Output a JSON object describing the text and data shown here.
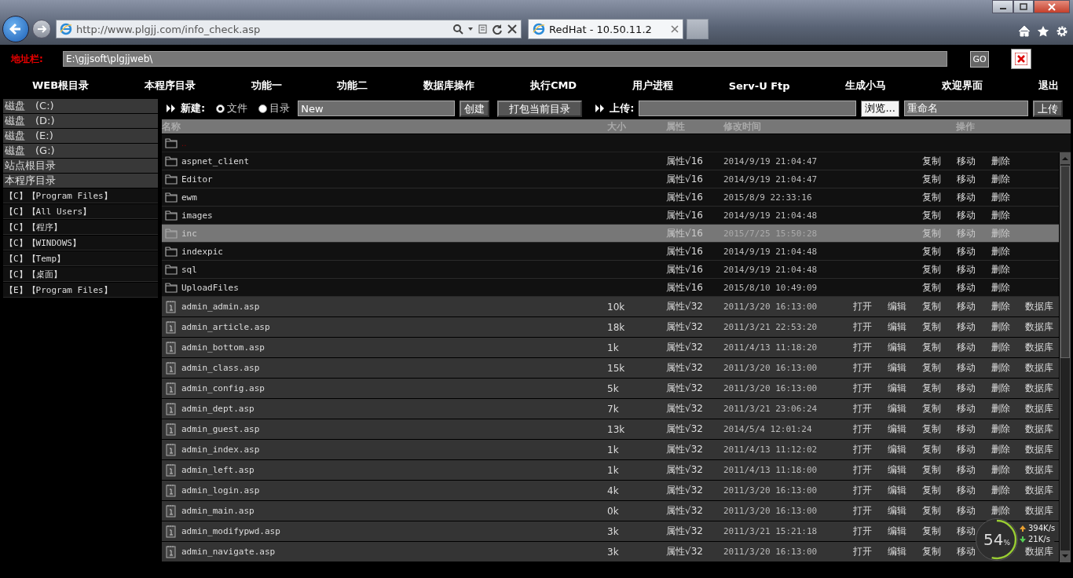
{
  "browser": {
    "url": "http://www.plgjj.com/info_check.asp",
    "tabs": [
      {
        "title": "RedHat - 10.50.11.2",
        "selected": true
      }
    ]
  },
  "address_bar": {
    "label": "地址栏:",
    "value": "E:\\gjjsoft\\plgjjweb\\",
    "go_button": "GO"
  },
  "nav": [
    "WEB根目录",
    "本程序目录",
    "功能一",
    "功能二",
    "数据库操作",
    "执行CMD",
    "用户进程",
    "Serv-U Ftp",
    "生成小马",
    "欢迎界面",
    "退出"
  ],
  "sidebar": {
    "items": [
      {
        "label": "磁盘　(C:)",
        "kind": "root"
      },
      {
        "label": "磁盘　(D:)",
        "kind": "root"
      },
      {
        "label": "磁盘　(E:)",
        "kind": "root"
      },
      {
        "label": "磁盘　(G:)",
        "kind": "root"
      },
      {
        "label": "站点根目录",
        "kind": "root"
      },
      {
        "label": "本程序目录",
        "kind": "root"
      },
      {
        "label": "【C】【Program Files】",
        "kind": "path"
      },
      {
        "label": "【C】【All Users】",
        "kind": "path"
      },
      {
        "label": "【C】【程序】",
        "kind": "path"
      },
      {
        "label": "【C】【WINDOWS】",
        "kind": "path"
      },
      {
        "label": "【C】【Temp】",
        "kind": "path"
      },
      {
        "label": "【C】【桌面】",
        "kind": "path"
      },
      {
        "label": "【E】【Program Files】",
        "kind": "path"
      }
    ]
  },
  "toolbar": {
    "new_label": "新建:",
    "options": [
      {
        "label": "文件",
        "selected": true
      },
      {
        "label": "目录",
        "selected": false
      }
    ],
    "name_value": "New",
    "create_button": "创建",
    "pack_button": "打包当前目录",
    "upload_label": "上传:",
    "browse_button": "浏览...",
    "rename_value": "重命名",
    "upload_button": "上传"
  },
  "table": {
    "columns": [
      "名称",
      "大小",
      "属性",
      "修改时间",
      "操作"
    ],
    "parent_row": {
      "name": ".."
    },
    "rows": [
      {
        "kind": "folder",
        "name": "aspnet_client",
        "attr": "属性√16",
        "time": "2014/9/19 21:04:47",
        "selected": false,
        "ops": [
          {
            "kind": "copy",
            "label": "复制"
          },
          {
            "kind": "move",
            "label": "移动"
          },
          {
            "kind": "delete",
            "label": "删除"
          }
        ]
      },
      {
        "kind": "folder",
        "name": "Editor",
        "attr": "属性√16",
        "time": "2014/9/19 21:04:47",
        "selected": false,
        "ops": [
          {
            "kind": "copy",
            "label": "复制"
          },
          {
            "kind": "move",
            "label": "移动"
          },
          {
            "kind": "delete",
            "label": "删除"
          }
        ]
      },
      {
        "kind": "folder",
        "name": "ewm",
        "attr": "属性√16",
        "time": "2015/8/9 22:33:16",
        "selected": false,
        "ops": [
          {
            "kind": "copy",
            "label": "复制"
          },
          {
            "kind": "move",
            "label": "移动"
          },
          {
            "kind": "delete",
            "label": "删除"
          }
        ]
      },
      {
        "kind": "folder",
        "name": "images",
        "attr": "属性√16",
        "time": "2014/9/19 21:04:48",
        "selected": false,
        "ops": [
          {
            "kind": "copy",
            "label": "复制"
          },
          {
            "kind": "move",
            "label": "移动"
          },
          {
            "kind": "delete",
            "label": "删除"
          }
        ]
      },
      {
        "kind": "folder",
        "name": "inc",
        "attr": "属性√16",
        "time": "2015/7/25 15:50:28",
        "selected": true,
        "ops": [
          {
            "kind": "copy",
            "label": "复制"
          },
          {
            "kind": "move",
            "label": "移动"
          },
          {
            "kind": "delete",
            "label": "删除"
          }
        ]
      },
      {
        "kind": "folder",
        "name": "indexpic",
        "attr": "属性√16",
        "time": "2014/9/19 21:04:48",
        "selected": false,
        "ops": [
          {
            "kind": "copy",
            "label": "复制"
          },
          {
            "kind": "move",
            "label": "移动"
          },
          {
            "kind": "delete",
            "label": "删除"
          }
        ]
      },
      {
        "kind": "folder",
        "name": "sql",
        "attr": "属性√16",
        "time": "2014/9/19 21:04:48",
        "selected": false,
        "ops": [
          {
            "kind": "copy",
            "label": "复制"
          },
          {
            "kind": "move",
            "label": "移动"
          },
          {
            "kind": "delete",
            "label": "删除"
          }
        ]
      },
      {
        "kind": "folder",
        "name": "UploadFiles",
        "attr": "属性√16",
        "time": "2015/8/10 10:49:09",
        "selected": false,
        "ops": [
          {
            "kind": "copy",
            "label": "复制"
          },
          {
            "kind": "move",
            "label": "移动"
          },
          {
            "kind": "delete",
            "label": "删除"
          }
        ]
      },
      {
        "kind": "file",
        "name": "admin_admin.asp",
        "size": "10k",
        "attr": "属性√32",
        "time": "2011/3/20 16:13:00",
        "selected": false,
        "ops": [
          {
            "kind": "open",
            "label": "打开"
          },
          {
            "kind": "edit",
            "label": "编辑"
          },
          {
            "kind": "copy",
            "label": "复制"
          },
          {
            "kind": "move",
            "label": "移动"
          },
          {
            "kind": "delete",
            "label": "删除"
          },
          {
            "kind": "database",
            "label": "数据库"
          }
        ]
      },
      {
        "kind": "file",
        "name": "admin_article.asp",
        "size": "18k",
        "attr": "属性√32",
        "time": "2011/3/21 22:53:20",
        "selected": false,
        "ops": [
          {
            "kind": "open",
            "label": "打开"
          },
          {
            "kind": "edit",
            "label": "编辑"
          },
          {
            "kind": "copy",
            "label": "复制"
          },
          {
            "kind": "move",
            "label": "移动"
          },
          {
            "kind": "delete",
            "label": "删除"
          },
          {
            "kind": "database",
            "label": "数据库"
          }
        ]
      },
      {
        "kind": "file",
        "name": "admin_bottom.asp",
        "size": "1k",
        "attr": "属性√32",
        "time": "2011/4/13 11:18:20",
        "selected": false,
        "ops": [
          {
            "kind": "open",
            "label": "打开"
          },
          {
            "kind": "edit",
            "label": "编辑"
          },
          {
            "kind": "copy",
            "label": "复制"
          },
          {
            "kind": "move",
            "label": "移动"
          },
          {
            "kind": "delete",
            "label": "删除"
          },
          {
            "kind": "database",
            "label": "数据库"
          }
        ]
      },
      {
        "kind": "file",
        "name": "admin_class.asp",
        "size": "15k",
        "attr": "属性√32",
        "time": "2011/3/20 16:13:00",
        "selected": false,
        "ops": [
          {
            "kind": "open",
            "label": "打开"
          },
          {
            "kind": "edit",
            "label": "编辑"
          },
          {
            "kind": "copy",
            "label": "复制"
          },
          {
            "kind": "move",
            "label": "移动"
          },
          {
            "kind": "delete",
            "label": "删除"
          },
          {
            "kind": "database",
            "label": "数据库"
          }
        ]
      },
      {
        "kind": "file",
        "name": "admin_config.asp",
        "size": "5k",
        "attr": "属性√32",
        "time": "2011/3/20 16:13:00",
        "selected": false,
        "ops": [
          {
            "kind": "open",
            "label": "打开"
          },
          {
            "kind": "edit",
            "label": "编辑"
          },
          {
            "kind": "copy",
            "label": "复制"
          },
          {
            "kind": "move",
            "label": "移动"
          },
          {
            "kind": "delete",
            "label": "删除"
          },
          {
            "kind": "database",
            "label": "数据库"
          }
        ]
      },
      {
        "kind": "file",
        "name": "admin_dept.asp",
        "size": "7k",
        "attr": "属性√32",
        "time": "2011/3/21 23:06:24",
        "selected": false,
        "ops": [
          {
            "kind": "open",
            "label": "打开"
          },
          {
            "kind": "edit",
            "label": "编辑"
          },
          {
            "kind": "copy",
            "label": "复制"
          },
          {
            "kind": "move",
            "label": "移动"
          },
          {
            "kind": "delete",
            "label": "删除"
          },
          {
            "kind": "database",
            "label": "数据库"
          }
        ]
      },
      {
        "kind": "file",
        "name": "admin_guest.asp",
        "size": "13k",
        "attr": "属性√32",
        "time": "2014/5/4 12:01:24",
        "selected": false,
        "ops": [
          {
            "kind": "open",
            "label": "打开"
          },
          {
            "kind": "edit",
            "label": "编辑"
          },
          {
            "kind": "copy",
            "label": "复制"
          },
          {
            "kind": "move",
            "label": "移动"
          },
          {
            "kind": "delete",
            "label": "删除"
          },
          {
            "kind": "database",
            "label": "数据库"
          }
        ]
      },
      {
        "kind": "file",
        "name": "admin_index.asp",
        "size": "1k",
        "attr": "属性√32",
        "time": "2011/4/13 11:12:02",
        "selected": false,
        "ops": [
          {
            "kind": "open",
            "label": "打开"
          },
          {
            "kind": "edit",
            "label": "编辑"
          },
          {
            "kind": "copy",
            "label": "复制"
          },
          {
            "kind": "move",
            "label": "移动"
          },
          {
            "kind": "delete",
            "label": "删除"
          },
          {
            "kind": "database",
            "label": "数据库"
          }
        ]
      },
      {
        "kind": "file",
        "name": "admin_left.asp",
        "size": "1k",
        "attr": "属性√32",
        "time": "2011/4/13 11:18:00",
        "selected": false,
        "ops": [
          {
            "kind": "open",
            "label": "打开"
          },
          {
            "kind": "edit",
            "label": "编辑"
          },
          {
            "kind": "copy",
            "label": "复制"
          },
          {
            "kind": "move",
            "label": "移动"
          },
          {
            "kind": "delete",
            "label": "删除"
          },
          {
            "kind": "database",
            "label": "数据库"
          }
        ]
      },
      {
        "kind": "file",
        "name": "admin_login.asp",
        "size": "4k",
        "attr": "属性√32",
        "time": "2011/3/20 16:13:00",
        "selected": false,
        "ops": [
          {
            "kind": "open",
            "label": "打开"
          },
          {
            "kind": "edit",
            "label": "编辑"
          },
          {
            "kind": "copy",
            "label": "复制"
          },
          {
            "kind": "move",
            "label": "移动"
          },
          {
            "kind": "delete",
            "label": "删除"
          },
          {
            "kind": "database",
            "label": "数据库"
          }
        ]
      },
      {
        "kind": "file",
        "name": "admin_main.asp",
        "size": "0k",
        "attr": "属性√32",
        "time": "2011/3/20 16:13:00",
        "selected": false,
        "ops": [
          {
            "kind": "open",
            "label": "打开"
          },
          {
            "kind": "edit",
            "label": "编辑"
          },
          {
            "kind": "copy",
            "label": "复制"
          },
          {
            "kind": "move",
            "label": "移动"
          },
          {
            "kind": "delete",
            "label": "删除"
          },
          {
            "kind": "database",
            "label": "数据库"
          }
        ]
      },
      {
        "kind": "file",
        "name": "admin_modifypwd.asp",
        "size": "3k",
        "attr": "属性√32",
        "time": "2011/3/21 15:21:18",
        "selected": false,
        "ops": [
          {
            "kind": "open",
            "label": "打开"
          },
          {
            "kind": "edit",
            "label": "编辑"
          },
          {
            "kind": "copy",
            "label": "复制"
          },
          {
            "kind": "move",
            "label": "移动"
          }
        ]
      },
      {
        "kind": "file",
        "name": "admin_navigate.asp",
        "size": "3k",
        "attr": "属性√32",
        "time": "2011/3/20 16:13:00",
        "selected": false,
        "ops": [
          {
            "kind": "open",
            "label": "打开"
          },
          {
            "kind": "edit",
            "label": "编辑"
          },
          {
            "kind": "copy",
            "label": "复制"
          },
          {
            "kind": "move",
            "label": "移动"
          },
          {
            "kind": "database",
            "label": "数据库"
          }
        ]
      }
    ]
  },
  "network": {
    "percent": "54",
    "unit": "%",
    "level": 0.54,
    "upload": "394K/s",
    "download": "21K/s"
  }
}
